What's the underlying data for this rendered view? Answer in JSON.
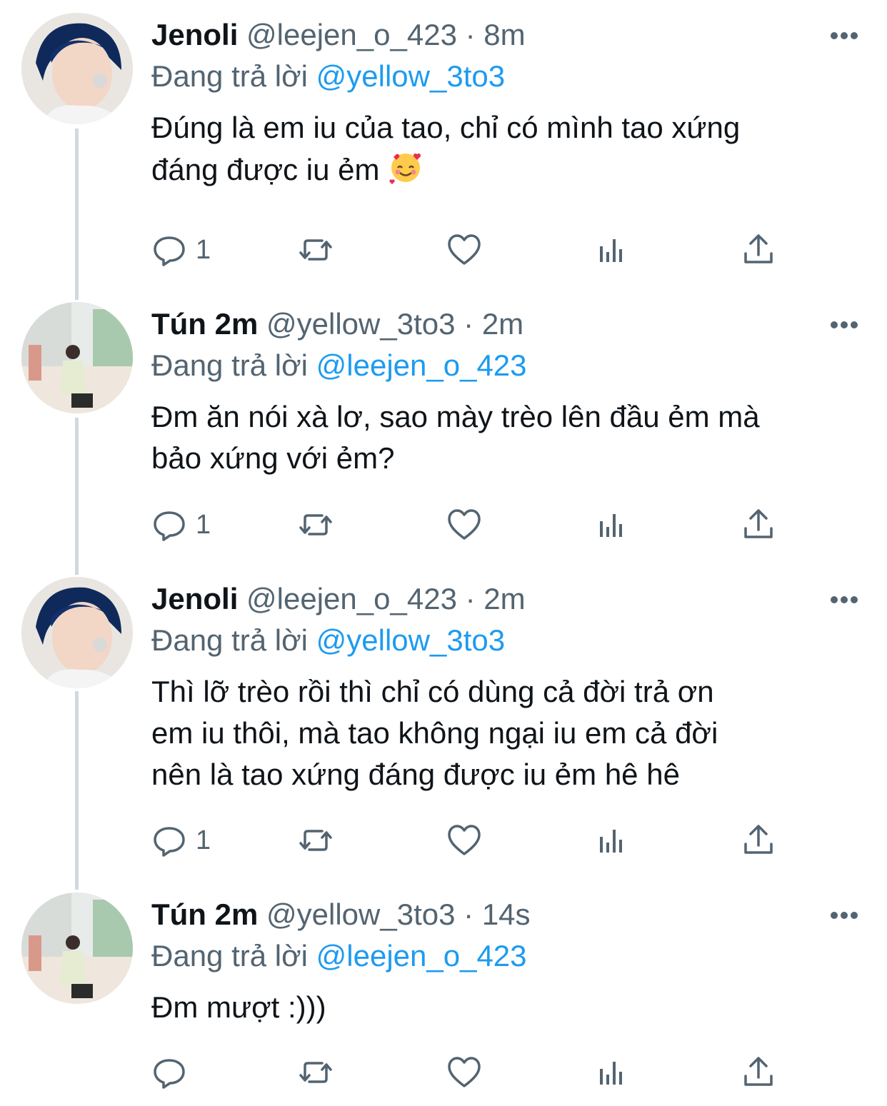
{
  "tweets": [
    {
      "name": "Jenoli",
      "handle": "@leejen_o_423",
      "dot": "·",
      "time": "8m",
      "reply_prefix": "Đang trả lời",
      "reply_to": "@yellow_3to3",
      "lines": [
        "Đúng là em iu của tao, chỉ có mình tao xứng",
        "đáng được iu ẻm"
      ],
      "emoji": "smiling-face-with-hearts",
      "reply_count": "1",
      "avatar": "jenoli-avatar"
    },
    {
      "name": "Tún 2m",
      "handle": "@yellow_3to3",
      "dot": "·",
      "time": "2m",
      "reply_prefix": "Đang trả lời",
      "reply_to": "@leejen_o_423",
      "lines": [
        "Đm ăn nói xà lơ, sao mày trèo lên đầu ẻm mà",
        "bảo xứng với ẻm?"
      ],
      "reply_count": "1",
      "avatar": "tun-avatar"
    },
    {
      "name": "Jenoli",
      "handle": "@leejen_o_423",
      "dot": "·",
      "time": "2m",
      "reply_prefix": "Đang trả lời",
      "reply_to": "@yellow_3to3",
      "lines": [
        "Thì lỡ trèo rồi thì chỉ có dùng cả đời trả ơn",
        "em iu thôi, mà tao không ngại iu em cả đời",
        "nên là tao xứng đáng được iu ẻm hê hê"
      ],
      "reply_count": "1",
      "avatar": "jenoli-avatar"
    },
    {
      "name": "Tún 2m",
      "handle": "@yellow_3to3",
      "dot": "·",
      "time": "14s",
      "reply_prefix": "Đang trả lời",
      "reply_to": "@leejen_o_423",
      "lines": [
        "Đm mượt :)))"
      ],
      "reply_count": "",
      "avatar": "tun-avatar"
    }
  ],
  "colors": {
    "text": "#0f1419",
    "secondary": "#536471",
    "link": "#1d9bf0",
    "thread": "#cfd9de"
  },
  "icons": [
    "reply-icon",
    "retweet-icon",
    "like-icon",
    "analytics-icon",
    "share-icon",
    "more-icon"
  ]
}
